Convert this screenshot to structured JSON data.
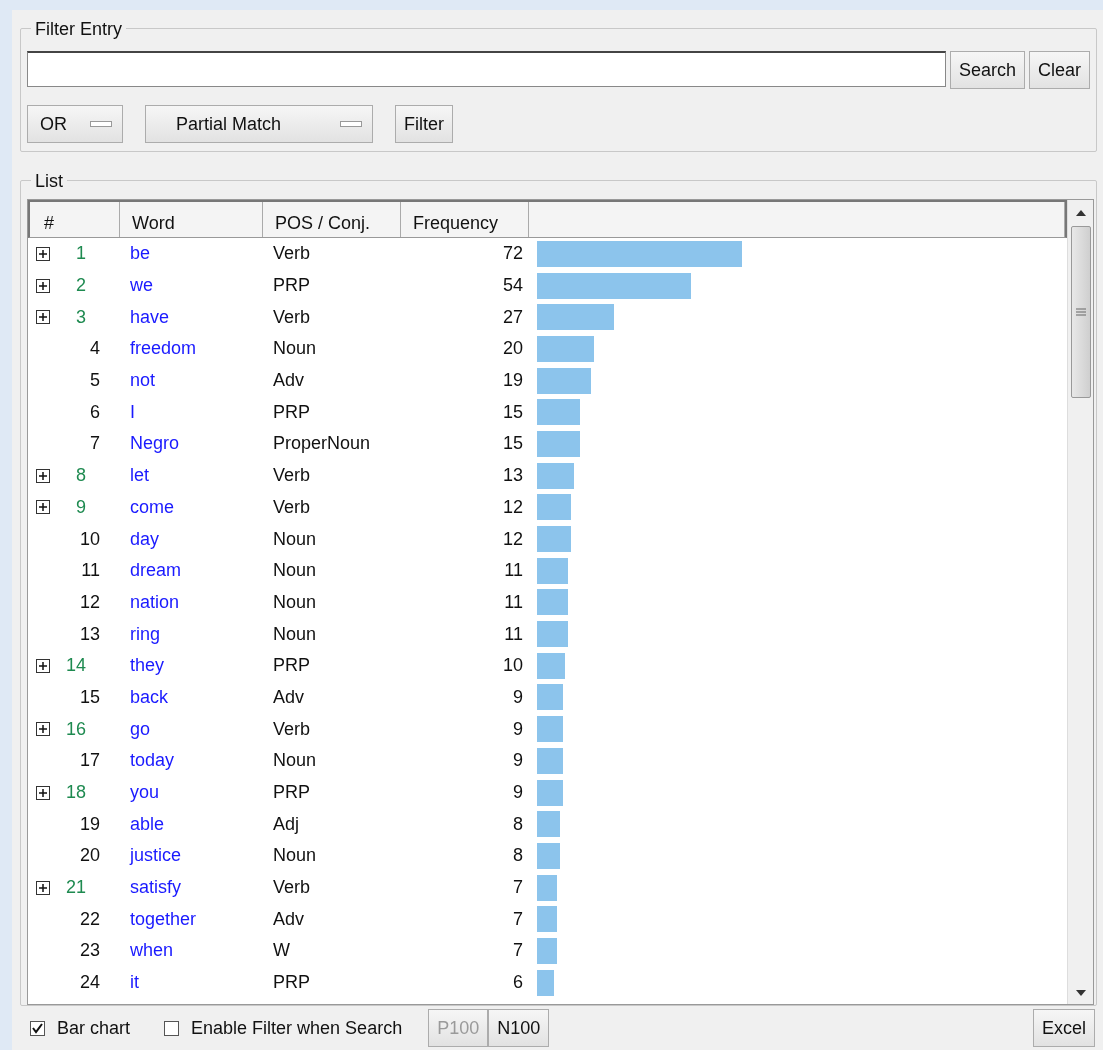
{
  "filter_entry": {
    "title": "Filter Entry",
    "buttons": [
      {
        "label": "Search"
      },
      {
        "label": "Clear"
      }
    ],
    "dropdowns": [
      {
        "value": "OR"
      },
      {
        "value": "Partial Match"
      }
    ],
    "filter_button": {
      "label": "Filter"
    }
  },
  "list": {
    "title": "List",
    "columns": [
      "#",
      "Word",
      "POS / Conj.",
      "Frequency"
    ],
    "rows": [
      {
        "expandable": true,
        "index": "1",
        "word": "be",
        "pos": "Verb",
        "frequency": "72"
      },
      {
        "expandable": true,
        "index": "2",
        "word": "we",
        "pos": "PRP",
        "frequency": "54"
      },
      {
        "expandable": true,
        "index": "3",
        "word": "have",
        "pos": "Verb",
        "frequency": "27"
      },
      {
        "expandable": false,
        "index": "4",
        "word": "freedom",
        "pos": "Noun",
        "frequency": "20"
      },
      {
        "expandable": false,
        "index": "5",
        "word": "not",
        "pos": "Adv",
        "frequency": "19"
      },
      {
        "expandable": false,
        "index": "6",
        "word": "I",
        "pos": "PRP",
        "frequency": "15"
      },
      {
        "expandable": false,
        "index": "7",
        "word": "Negro",
        "pos": "ProperNoun",
        "frequency": "15"
      },
      {
        "expandable": true,
        "index": "8",
        "word": "let",
        "pos": "Verb",
        "frequency": "13"
      },
      {
        "expandable": true,
        "index": "9",
        "word": "come",
        "pos": "Verb",
        "frequency": "12"
      },
      {
        "expandable": false,
        "index": "10",
        "word": "day",
        "pos": "Noun",
        "frequency": "12"
      },
      {
        "expandable": false,
        "index": "11",
        "word": "dream",
        "pos": "Noun",
        "frequency": "11"
      },
      {
        "expandable": false,
        "index": "12",
        "word": "nation",
        "pos": "Noun",
        "frequency": "11"
      },
      {
        "expandable": false,
        "index": "13",
        "word": "ring",
        "pos": "Noun",
        "frequency": "11"
      },
      {
        "expandable": true,
        "index": "14",
        "word": "they",
        "pos": "PRP",
        "frequency": "10"
      },
      {
        "expandable": false,
        "index": "15",
        "word": "back",
        "pos": "Adv",
        "frequency": "9"
      },
      {
        "expandable": true,
        "index": "16",
        "word": "go",
        "pos": "Verb",
        "frequency": "9"
      },
      {
        "expandable": false,
        "index": "17",
        "word": "today",
        "pos": "Noun",
        "frequency": "9"
      },
      {
        "expandable": true,
        "index": "18",
        "word": "you",
        "pos": "PRP",
        "frequency": "9"
      },
      {
        "expandable": false,
        "index": "19",
        "word": "able",
        "pos": "Adj",
        "frequency": "8"
      },
      {
        "expandable": false,
        "index": "20",
        "word": "justice",
        "pos": "Noun",
        "frequency": "8"
      },
      {
        "expandable": true,
        "index": "21",
        "word": "satisfy",
        "pos": "Verb",
        "frequency": "7"
      },
      {
        "expandable": false,
        "index": "22",
        "word": "together",
        "pos": "Adv",
        "frequency": "7"
      },
      {
        "expandable": false,
        "index": "23",
        "word": "when",
        "pos": "W",
        "frequency": "7"
      },
      {
        "expandable": false,
        "index": "24",
        "word": "it",
        "pos": "PRP",
        "frequency": "6"
      }
    ]
  },
  "bottom_bar": {
    "checkboxes": [
      {
        "label": "Bar chart",
        "checked": true
      },
      {
        "label": "Enable Filter when Search",
        "checked": false
      }
    ],
    "page_buttons": [
      {
        "label": "P100",
        "disabled": true
      },
      {
        "label": "N100",
        "disabled": false
      }
    ],
    "export_button": {
      "label": "Excel"
    }
  }
}
